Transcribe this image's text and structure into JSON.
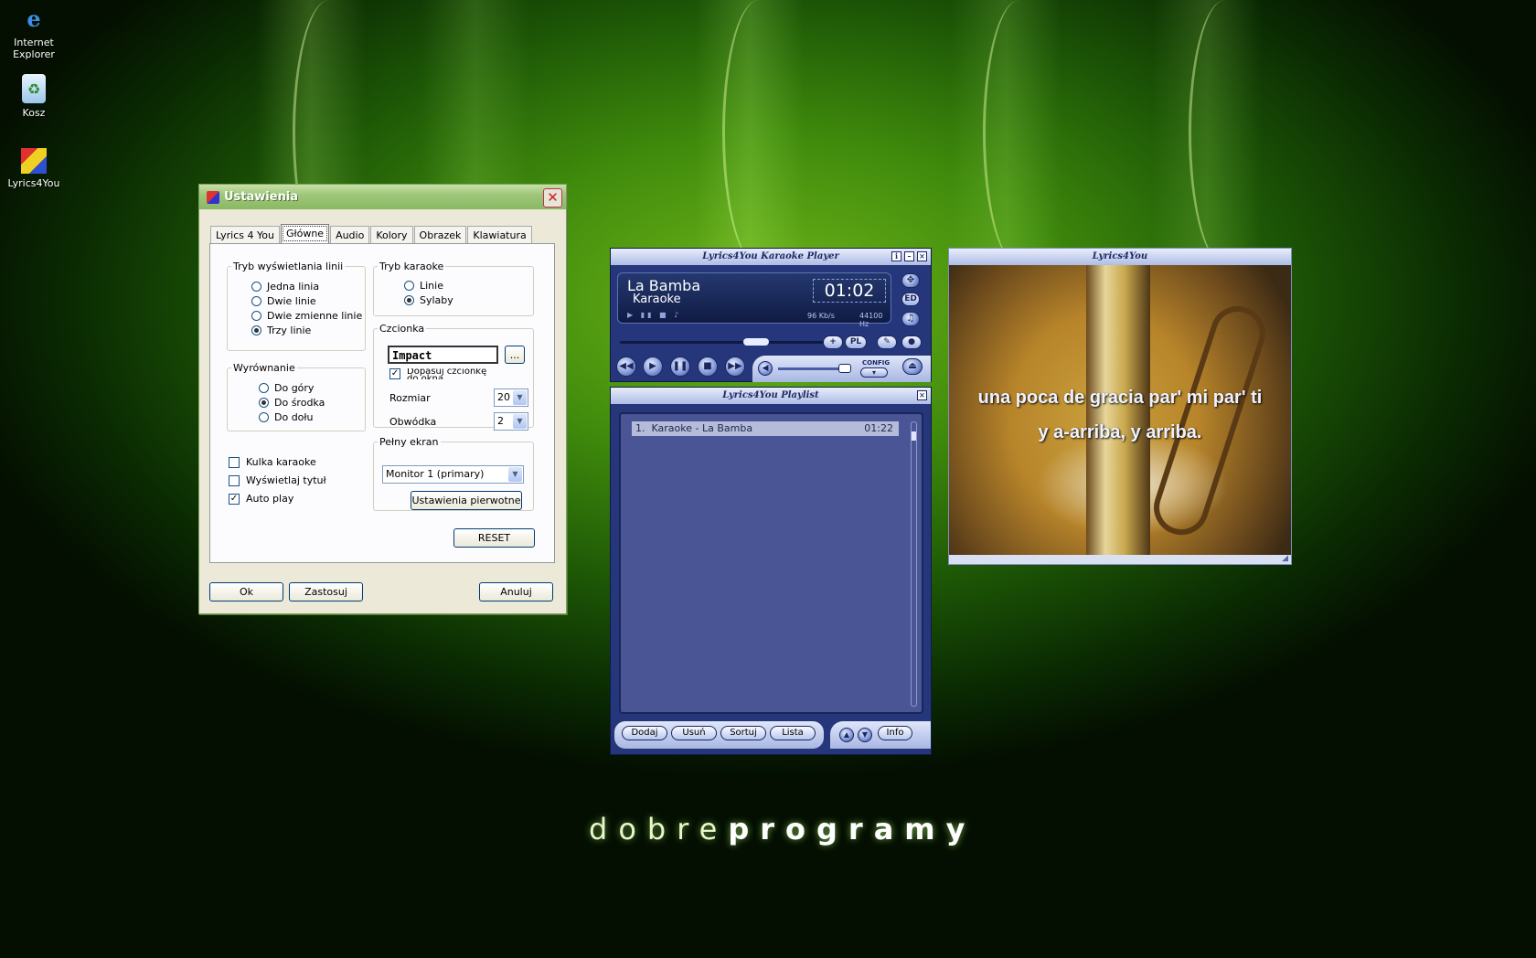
{
  "desktop": {
    "icons": [
      {
        "label": "Internet Explorer",
        "icon": "internet-explorer-icon"
      },
      {
        "label": "Kosz",
        "icon": "recycle-bin-icon"
      },
      {
        "label": "Lyrics4You",
        "icon": "lyrics4you-app-icon"
      }
    ],
    "brand_light": "dobre",
    "brand_bold": "programy"
  },
  "settings": {
    "title": "Ustawienia",
    "tabs": [
      "Lyrics 4 You",
      "Główne",
      "Audio",
      "Kolory",
      "Obrazek",
      "Klawiatura"
    ],
    "selected_tab": "Główne",
    "line_mode": {
      "legend": "Tryb wyświetlania linii",
      "options": [
        "Jedna linia",
        "Dwie linie",
        "Dwie zmienne linie",
        "Trzy linie"
      ],
      "selected": "Trzy linie"
    },
    "karaoke_mode": {
      "legend": "Tryb karaoke",
      "options": [
        "Linie",
        "Sylaby"
      ],
      "selected": "Sylaby"
    },
    "alignment": {
      "legend": "Wyrównanie",
      "options": [
        "Do góry",
        "Do środka",
        "Do dołu"
      ],
      "selected": "Do środka"
    },
    "font": {
      "legend": "Czcionka",
      "value": "Impact",
      "browse": "...",
      "fit_label": "Dopasuj czcionkę do okna",
      "fit_checked": true,
      "size_label": "Rozmiar",
      "size_value": "20",
      "outline_label": "Obwódka",
      "outline_value": "2"
    },
    "checkboxes": [
      {
        "label": "Kulka karaoke",
        "checked": false
      },
      {
        "label": "Wyświetlaj tytuł",
        "checked": false
      },
      {
        "label": "Auto play",
        "checked": true
      }
    ],
    "fullscreen": {
      "legend": "Pełny ekran",
      "monitor": "Monitor 1 (primary)",
      "defaults_button": "Ustawienia pierwotne"
    },
    "reset_button": "RESET",
    "ok_button": "Ok",
    "apply_button": "Zastosuj",
    "cancel_button": "Anuluj"
  },
  "player": {
    "title": "Lyrics4You Karaoke Player",
    "song_title": "La Bamba",
    "song_sub": "Karaoke",
    "time": "01:02",
    "bitrate": "96 Kb/s",
    "samplerate": "44100 Hz",
    "config_label": "CONFIG",
    "pl_label": "PL",
    "ed_label": "ED"
  },
  "playlist": {
    "title": "Lyrics4You Playlist",
    "items": [
      {
        "num": "1.",
        "name": "Karaoke - La Bamba",
        "duration": "01:22"
      }
    ],
    "buttons": [
      "Dodaj",
      "Usuń",
      "Sortuj",
      "Lista"
    ],
    "info_button": "Info"
  },
  "video": {
    "title": "Lyrics4You",
    "line1": "una poca de gracia par' mi par' ti",
    "line2": "y a-arriba, y arriba."
  }
}
